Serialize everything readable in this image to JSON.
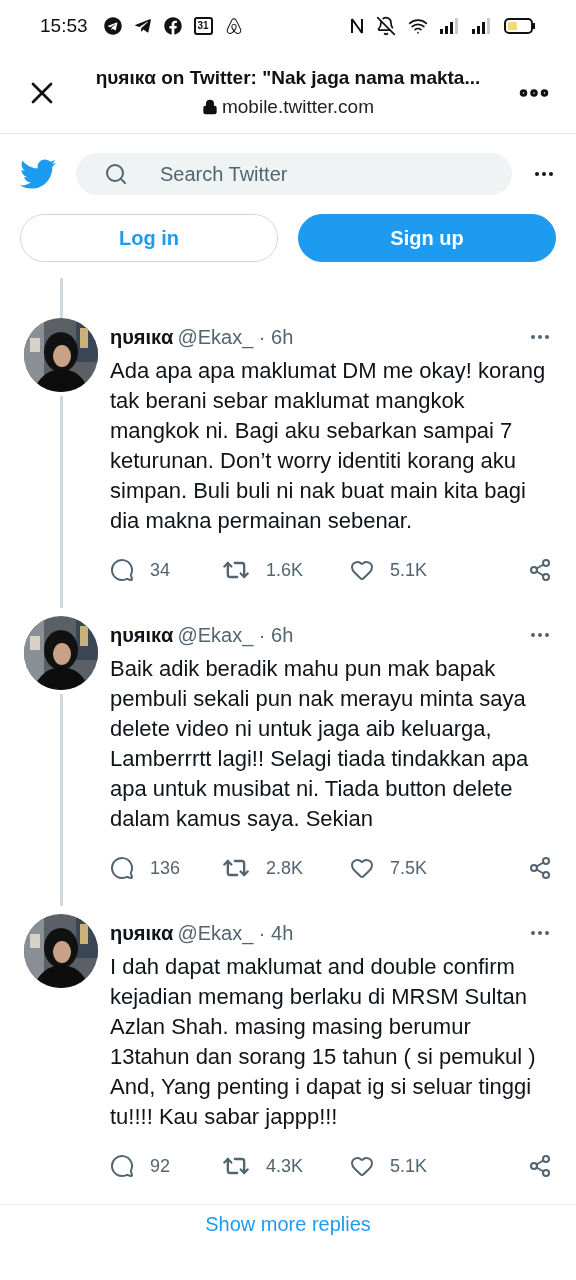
{
  "status_bar": {
    "time": "15:53",
    "calendar_day": "31"
  },
  "header": {
    "title": "ηυяιкα on Twitter: \"Nak jaga nama makta...",
    "url": "mobile.twitter.com"
  },
  "search": {
    "placeholder": "Search Twitter"
  },
  "auth_buttons": [
    {
      "label": "Log in",
      "kind": "outline"
    },
    {
      "label": "Sign up",
      "kind": "filled"
    }
  ],
  "tweets": [
    {
      "name": "ηυяιкα",
      "handle": "@Ekax_ · 6h",
      "text": "Ada apa apa maklumat DM me okay! korang tak berani sebar maklumat mangkok mangkok ni. Bagi aku sebarkan sampai  7 keturunan. Don’t worry identiti korang aku simpan. Buli buli ni nak buat main kita bagi dia makna permainan sebenar.",
      "replies": "34",
      "retweets": "1.6K",
      "likes": "5.1K"
    },
    {
      "name": "ηυяιкα",
      "handle": "@Ekax_ · 6h",
      "text": "Baik adik beradik mahu pun mak bapak pembuli sekali pun nak merayu minta saya delete video ni untuk jaga aib keluarga, Lamberrrtt lagi!! Selagi tiada tindakkan apa apa untuk musibat ni. Tiada button delete dalam kamus saya. Sekian",
      "replies": "136",
      "retweets": "2.8K",
      "likes": "7.5K"
    },
    {
      "name": "ηυяιкα",
      "handle": "@Ekax_ · 4h",
      "text": "I dah dapat maklumat and  double confirm kejadian memang berlaku di MRSM Sultan Azlan Shah. masing masing berumur 13tahun dan sorang 15 tahun ( si pemukul ) And, Yang penting i dapat ig si seluar tinggi tu!!!! Kau sabar jappp!!!",
      "replies": "92",
      "retweets": "4.3K",
      "likes": "5.1K"
    }
  ],
  "show_more": "Show more replies"
}
